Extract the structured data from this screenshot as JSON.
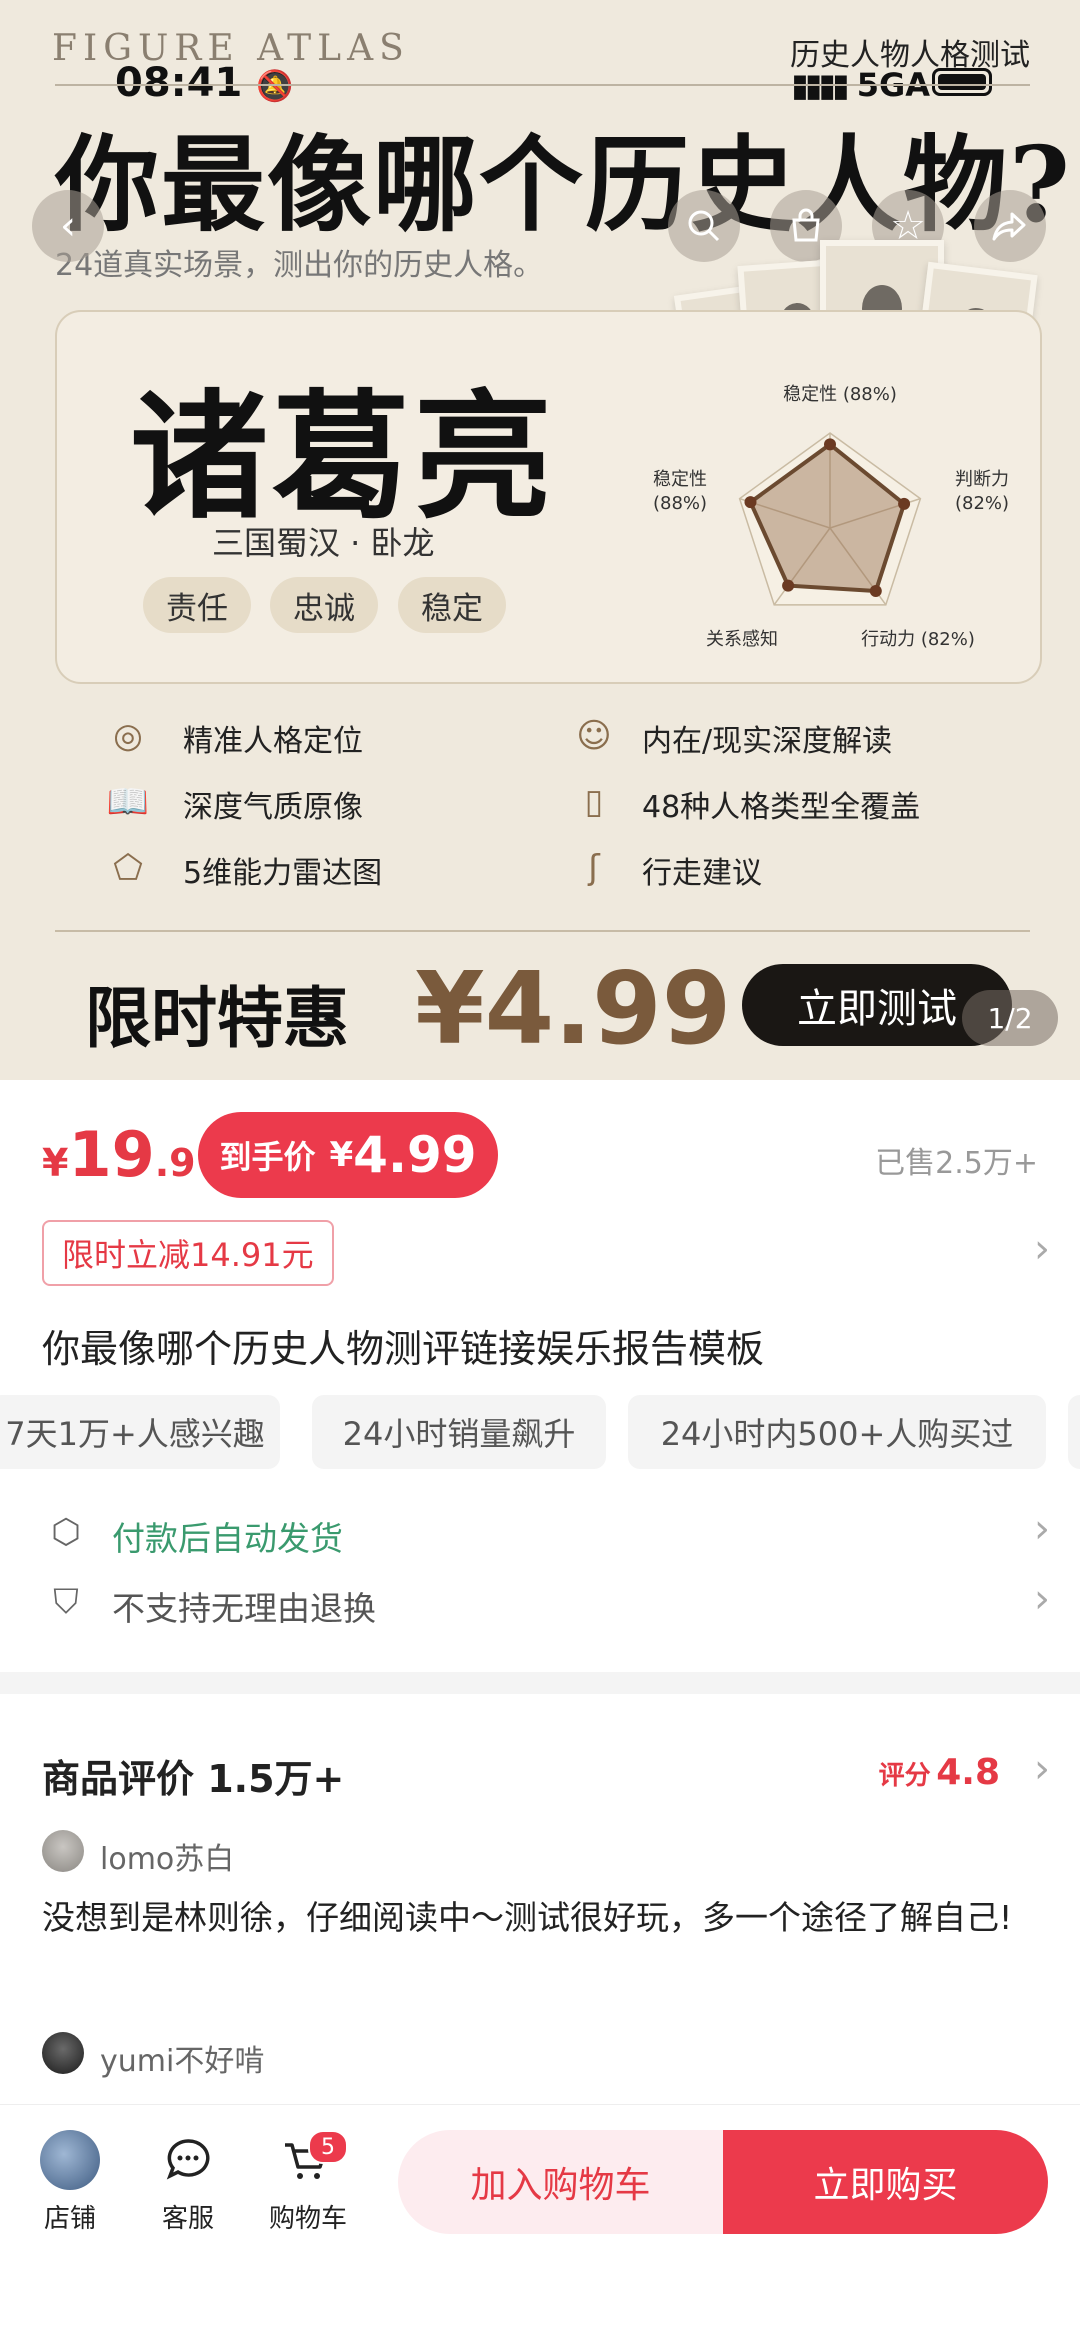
{
  "hero": {
    "brand": "FIGURE ATLAS",
    "top_subtitle": "历史人物人格测试",
    "status": {
      "time": "08:41",
      "network": "5GA"
    },
    "title": "你最像哪个历史人物?",
    "subtitle": "24道真实场景，测出你的历史人格。",
    "result": {
      "name": "诸葛亮",
      "dynasty": "三国蜀汉 · 卧龙",
      "tags": [
        "责任",
        "忠诚",
        "稳定"
      ]
    },
    "radar": {
      "labels": [
        {
          "text": "稳定性 (88%)",
          "value": 88
        },
        {
          "text": "判断力 (82%)",
          "value": 82
        },
        {
          "text": "行动力 (82%)",
          "value": 82
        },
        {
          "text": "关系感知",
          "value": 75
        },
        {
          "text": "稳定性 (88%)",
          "value": 88
        }
      ]
    },
    "features": [
      {
        "icon": "target-icon",
        "label": "精准人格定位"
      },
      {
        "icon": "mask-icon",
        "label": "内在/现实深度解读"
      },
      {
        "icon": "book-icon",
        "label": "深度气质原像"
      },
      {
        "icon": "cards-icon",
        "label": "48种人格类型全覆盖"
      },
      {
        "icon": "radar-icon",
        "label": "5维能力雷达图"
      },
      {
        "icon": "path-icon",
        "label": "行走建议"
      }
    ],
    "promo": "限时特惠",
    "promo_price": "¥4.99",
    "cta": "立即测试",
    "pager": "1/2"
  },
  "price": {
    "currency": "¥",
    "orig_int": "19",
    "orig_dec": ".9",
    "handed_label": "到手价",
    "handed_currency": "¥",
    "handed_value": "4.99",
    "sold": "已售2.5万+",
    "coupon": "限时立减14.91元"
  },
  "product_title": "你最像哪个历史人物测评链接娱乐报告模板",
  "chips": [
    "7天1万+人感兴趣",
    "24小时销量飙升",
    "24小时内500+人购买过"
  ],
  "services": [
    {
      "icon": "box-icon",
      "label": "付款后自动发货",
      "color": "#3a9a6e"
    },
    {
      "icon": "shield-icon",
      "label": "不支持无理由退换",
      "color": "#555555"
    }
  ],
  "reviews": {
    "heading": "商品评价 1.5万+",
    "score_label": "评分",
    "score": "4.8",
    "items": [
      {
        "user": "lomo苏白",
        "text": "没想到是林则徐，仔细阅读中～测试很好玩，多一个途径了解自己!"
      },
      {
        "user": "yumi不好啃",
        "text": ""
      }
    ]
  },
  "bottom_bar": {
    "store": "店铺",
    "service": "客服",
    "cart": "购物车",
    "cart_count": "5",
    "add_cart": "加入购物车",
    "buy_now": "立即购买"
  },
  "colors": {
    "accent": "#ec3a4c",
    "hero_bg": "#efe9dd",
    "gold": "#7a5a3c"
  }
}
